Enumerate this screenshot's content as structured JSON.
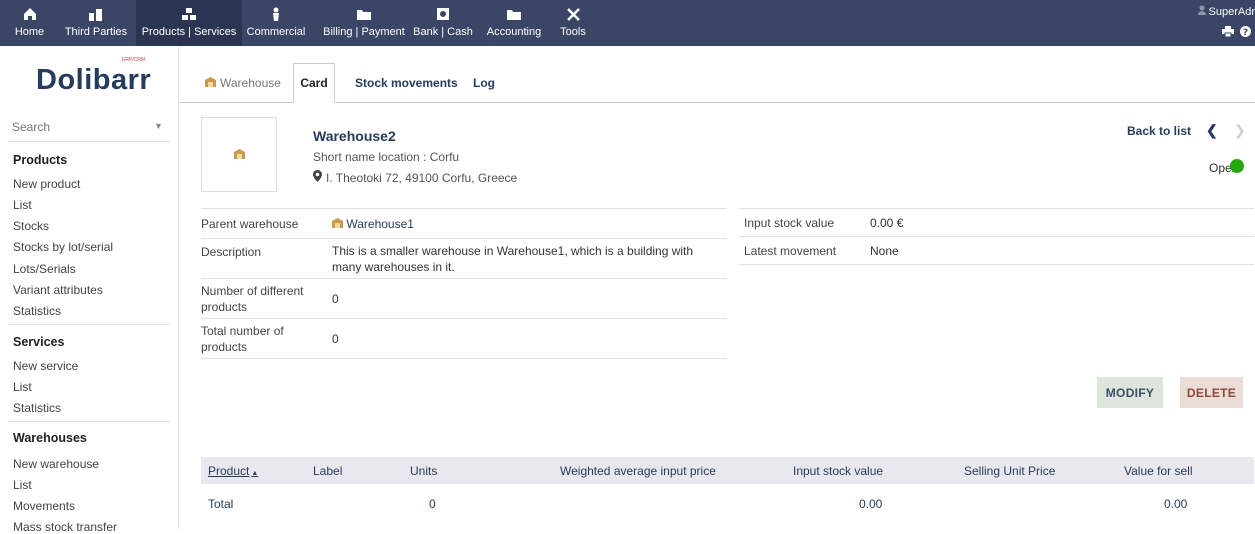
{
  "topmenu": [
    {
      "label": "Home",
      "icon": "home-icon"
    },
    {
      "label": "Third Parties",
      "icon": "third-parties-icon"
    },
    {
      "label": "Products | Services",
      "icon": "products-icon"
    },
    {
      "label": "Commercial",
      "icon": "commercial-icon"
    },
    {
      "label": "Billing | Payment",
      "icon": "billing-icon"
    },
    {
      "label": "Bank | Cash",
      "icon": "bank-icon"
    },
    {
      "label": "Accounting",
      "icon": "accounting-icon"
    },
    {
      "label": "Tools",
      "icon": "tools-icon"
    }
  ],
  "user": {
    "name": "SuperAdr"
  },
  "logo": {
    "text": "Dolibarr",
    "sub": "ERP/CRM"
  },
  "sidebar": {
    "search_placeholder": "Search",
    "sections": [
      {
        "title": "Products",
        "items": [
          "New product",
          "List",
          "Stocks",
          "Stocks by lot/serial",
          "Lots/Serials",
          "Variant attributes",
          "Statistics"
        ]
      },
      {
        "title": "Services",
        "items": [
          "New service",
          "List",
          "Statistics"
        ]
      },
      {
        "title": "Warehouses",
        "items": [
          "New warehouse",
          "List",
          "Movements",
          "Mass stock transfer"
        ]
      }
    ]
  },
  "tabs": {
    "warehouse": "Warehouse",
    "card": "Card",
    "movements": "Stock movements",
    "log": "Log"
  },
  "header": {
    "title": "Warehouse2",
    "short_name": "Short name location : Corfu",
    "address": "I. Theotoki 72, 49100 Corfu, Greece",
    "back_to_list": "Back to list",
    "status": "Open"
  },
  "fields_left": [
    {
      "label": "Parent warehouse",
      "value": "Warehouse1"
    },
    {
      "label": "Description",
      "value": "This is a smaller warehouse in Warehouse1, which is a building with many warehouses in it."
    },
    {
      "label": "Number of different products",
      "value": "0"
    },
    {
      "label": "Total number of products",
      "value": "0"
    }
  ],
  "fields_right": [
    {
      "label": "Input stock value",
      "value": "0.00 €"
    },
    {
      "label": "Latest movement",
      "value": "None"
    }
  ],
  "buttons": {
    "modify": "MODIFY",
    "delete": "DELETE"
  },
  "product_table": {
    "columns": [
      "Product",
      "Label",
      "Units",
      "Weighted average input price",
      "Input stock value",
      "Selling Unit Price",
      "Value for sell"
    ],
    "total": {
      "label": "Total",
      "units": "0",
      "input_stock_value": "0.00",
      "value_for_sell": "0.00"
    }
  },
  "colors": {
    "topbar": "#3b4666",
    "link": "#263c5c",
    "status_open": "#25a80b"
  }
}
